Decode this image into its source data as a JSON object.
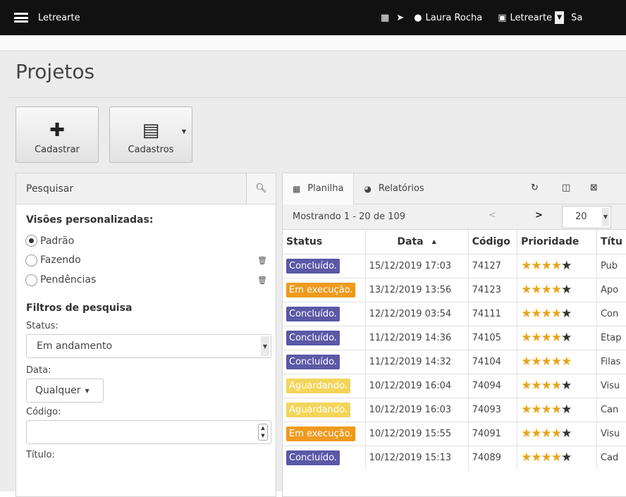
{
  "topbar": {
    "app_name": "Letrearte",
    "icons": [
      "calendar-icon",
      "send-icon",
      "user-icon",
      "building-icon"
    ],
    "user_name": "Laura Rocha",
    "company": "Letrearte",
    "logout": "Sa"
  },
  "page": {
    "title": "Projetos"
  },
  "actions": {
    "add_label": "Cadastrar",
    "records_label": "Cadastros"
  },
  "search_panel": {
    "title": "Pesquisar",
    "views_title": "Visões personalizadas:",
    "views": [
      {
        "label": "Padrão",
        "selected": true,
        "deletable": false
      },
      {
        "label": "Fazendo",
        "selected": false,
        "deletable": true
      },
      {
        "label": "Pendências",
        "selected": false,
        "deletable": true
      }
    ],
    "filters_title": "Filtros de pesquisa",
    "status_label": "Status:",
    "status_value": "Em andamento",
    "date_label": "Data:",
    "date_value": "Qualquer",
    "code_label": "Código:",
    "code_value": "",
    "title_label": "Título:"
  },
  "results_panel": {
    "tab_sheet": "Planilha",
    "tab_reports": "Relatórios",
    "showing_text": "Mostrando 1 - 20 de 109",
    "page_size": "20",
    "columns": [
      "Status",
      "Data",
      "Código",
      "Prioridade",
      "Títu"
    ],
    "rows": [
      {
        "status": "Concluído.",
        "status_color": "#5b58a6",
        "date": "15/12/2019 17:03",
        "code": "74127",
        "stars": 4,
        "title": "Pub"
      },
      {
        "status": "Em execução.",
        "status_color": "#ef9a1e",
        "date": "13/12/2019 13:56",
        "code": "74123",
        "stars": 4,
        "title": "Apo"
      },
      {
        "status": "Concluído.",
        "status_color": "#5b58a6",
        "date": "12/12/2019 03:54",
        "code": "74111",
        "stars": 4,
        "title": "Con"
      },
      {
        "status": "Concluído.",
        "status_color": "#5b58a6",
        "date": "11/12/2019 14:36",
        "code": "74105",
        "stars": 4,
        "title": "Etap"
      },
      {
        "status": "Concluído.",
        "status_color": "#5b58a6",
        "date": "11/12/2019 14:32",
        "code": "74104",
        "stars": 5,
        "title": "Filas"
      },
      {
        "status": "Aguardando.",
        "status_color": "#f3d55b",
        "date": "10/12/2019 16:04",
        "code": "74094",
        "stars": 4,
        "title": "Visu"
      },
      {
        "status": "Aguardando.",
        "status_color": "#f3d55b",
        "date": "10/12/2019 16:03",
        "code": "74093",
        "stars": 4,
        "title": "Can"
      },
      {
        "status": "Em execução.",
        "status_color": "#ef9a1e",
        "date": "10/12/2019 15:55",
        "code": "74091",
        "stars": 4,
        "title": "Visu"
      },
      {
        "status": "Concluído.",
        "status_color": "#5b58a6",
        "date": "10/12/2019 15:13",
        "code": "74089",
        "stars": 4,
        "title": "Cad"
      }
    ]
  }
}
